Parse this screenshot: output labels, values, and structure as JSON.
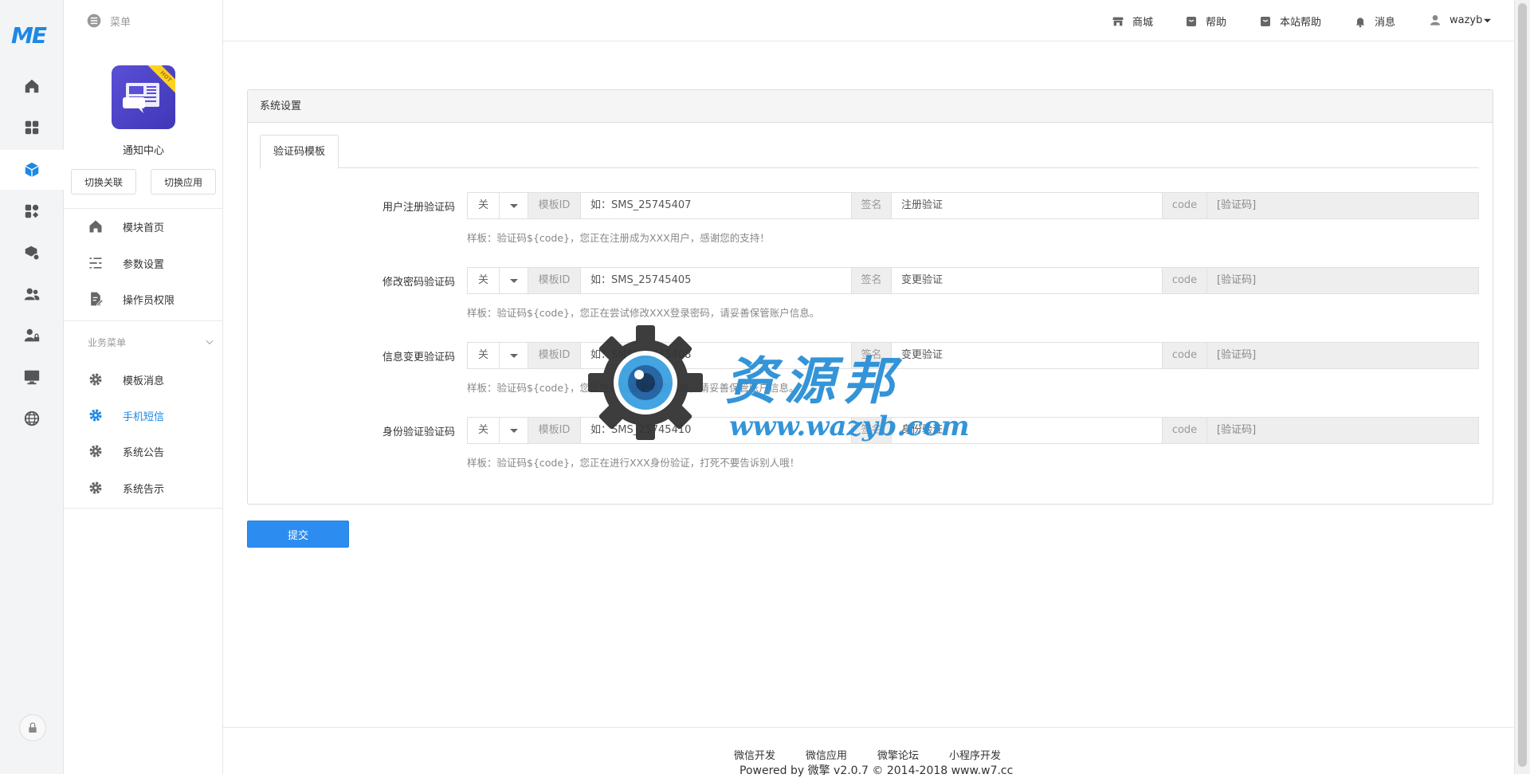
{
  "rail": {
    "logo": "ME",
    "icons": [
      "home-icon",
      "apps-icon",
      "cube-icon",
      "modules-icon",
      "package-icon",
      "users-icon",
      "user-lock-icon",
      "monitor-icon",
      "globe-icon"
    ],
    "active_index": 2
  },
  "sidebar": {
    "menu_label": "菜单",
    "app_name": "通知中心",
    "app_badge": "HOT",
    "switch_buttons": [
      "切换关联",
      "切换应用"
    ],
    "items": [
      {
        "label": "模块首页",
        "icon": "home-icon"
      },
      {
        "label": "参数设置",
        "icon": "list-settings-icon"
      },
      {
        "label": "操作员权限",
        "icon": "document-edit-icon"
      }
    ],
    "group_title": "业务菜单",
    "group_items": [
      {
        "label": "模板消息",
        "icon": "gear-icon",
        "active": false
      },
      {
        "label": "手机短信",
        "icon": "gear-icon",
        "active": true
      },
      {
        "label": "系统公告",
        "icon": "gear-icon",
        "active": false
      },
      {
        "label": "系统告示",
        "icon": "gear-icon",
        "active": false
      }
    ]
  },
  "header": {
    "links": [
      {
        "label": "商城",
        "icon": "store-icon"
      },
      {
        "label": "帮助",
        "icon": "help-icon"
      },
      {
        "label": "本站帮助",
        "icon": "site-help-icon"
      },
      {
        "label": "消息",
        "icon": "bell-icon"
      },
      {
        "label": "wazyb",
        "icon": "user-icon"
      }
    ]
  },
  "panel": {
    "title": "系统设置",
    "tab": "验证码模板",
    "addons": {
      "template_id": "模板ID",
      "sign": "签名",
      "code": "code"
    },
    "rows": [
      {
        "label": "用户注册验证码",
        "switch": "关",
        "template_placeholder": "如：SMS_25745407",
        "sign_placeholder": "注册验证",
        "code_value": "[验证码]",
        "help": "样板：验证码${code}，您正在注册成为XXX用户，感谢您的支持！"
      },
      {
        "label": "修改密码验证码",
        "switch": "关",
        "template_placeholder": "如：SMS_25745405",
        "sign_placeholder": "变更验证",
        "code_value": "[验证码]",
        "help": "样板：验证码${code}，您正在尝试修改XXX登录密码，请妥善保管账户信息。"
      },
      {
        "label": "信息变更验证码",
        "switch": "关",
        "template_placeholder": "如：SMS_25745408",
        "sign_placeholder": "变更验证",
        "code_value": "[验证码]",
        "help": "样板：验证码${code}，您正在尝试变更重要信息，请妥善保管账户信息。"
      },
      {
        "label": "身份验证验证码",
        "switch": "关",
        "template_placeholder": "如：SMS_25745410",
        "sign_placeholder": "身份验证",
        "code_value": "[验证码]",
        "help": "样板：验证码${code}，您正在进行XXX身份验证，打死不要告诉别人哦！"
      }
    ],
    "submit": "提交"
  },
  "footer": {
    "links": [
      "微信开发",
      "微信应用",
      "微擎论坛",
      "小程序开发"
    ],
    "copyright": "Powered by 微擎 v2.0.7 © 2014-2018 www.w7.cc"
  },
  "watermark": {
    "title": "资源邦",
    "url": "www.wazyb.com"
  }
}
